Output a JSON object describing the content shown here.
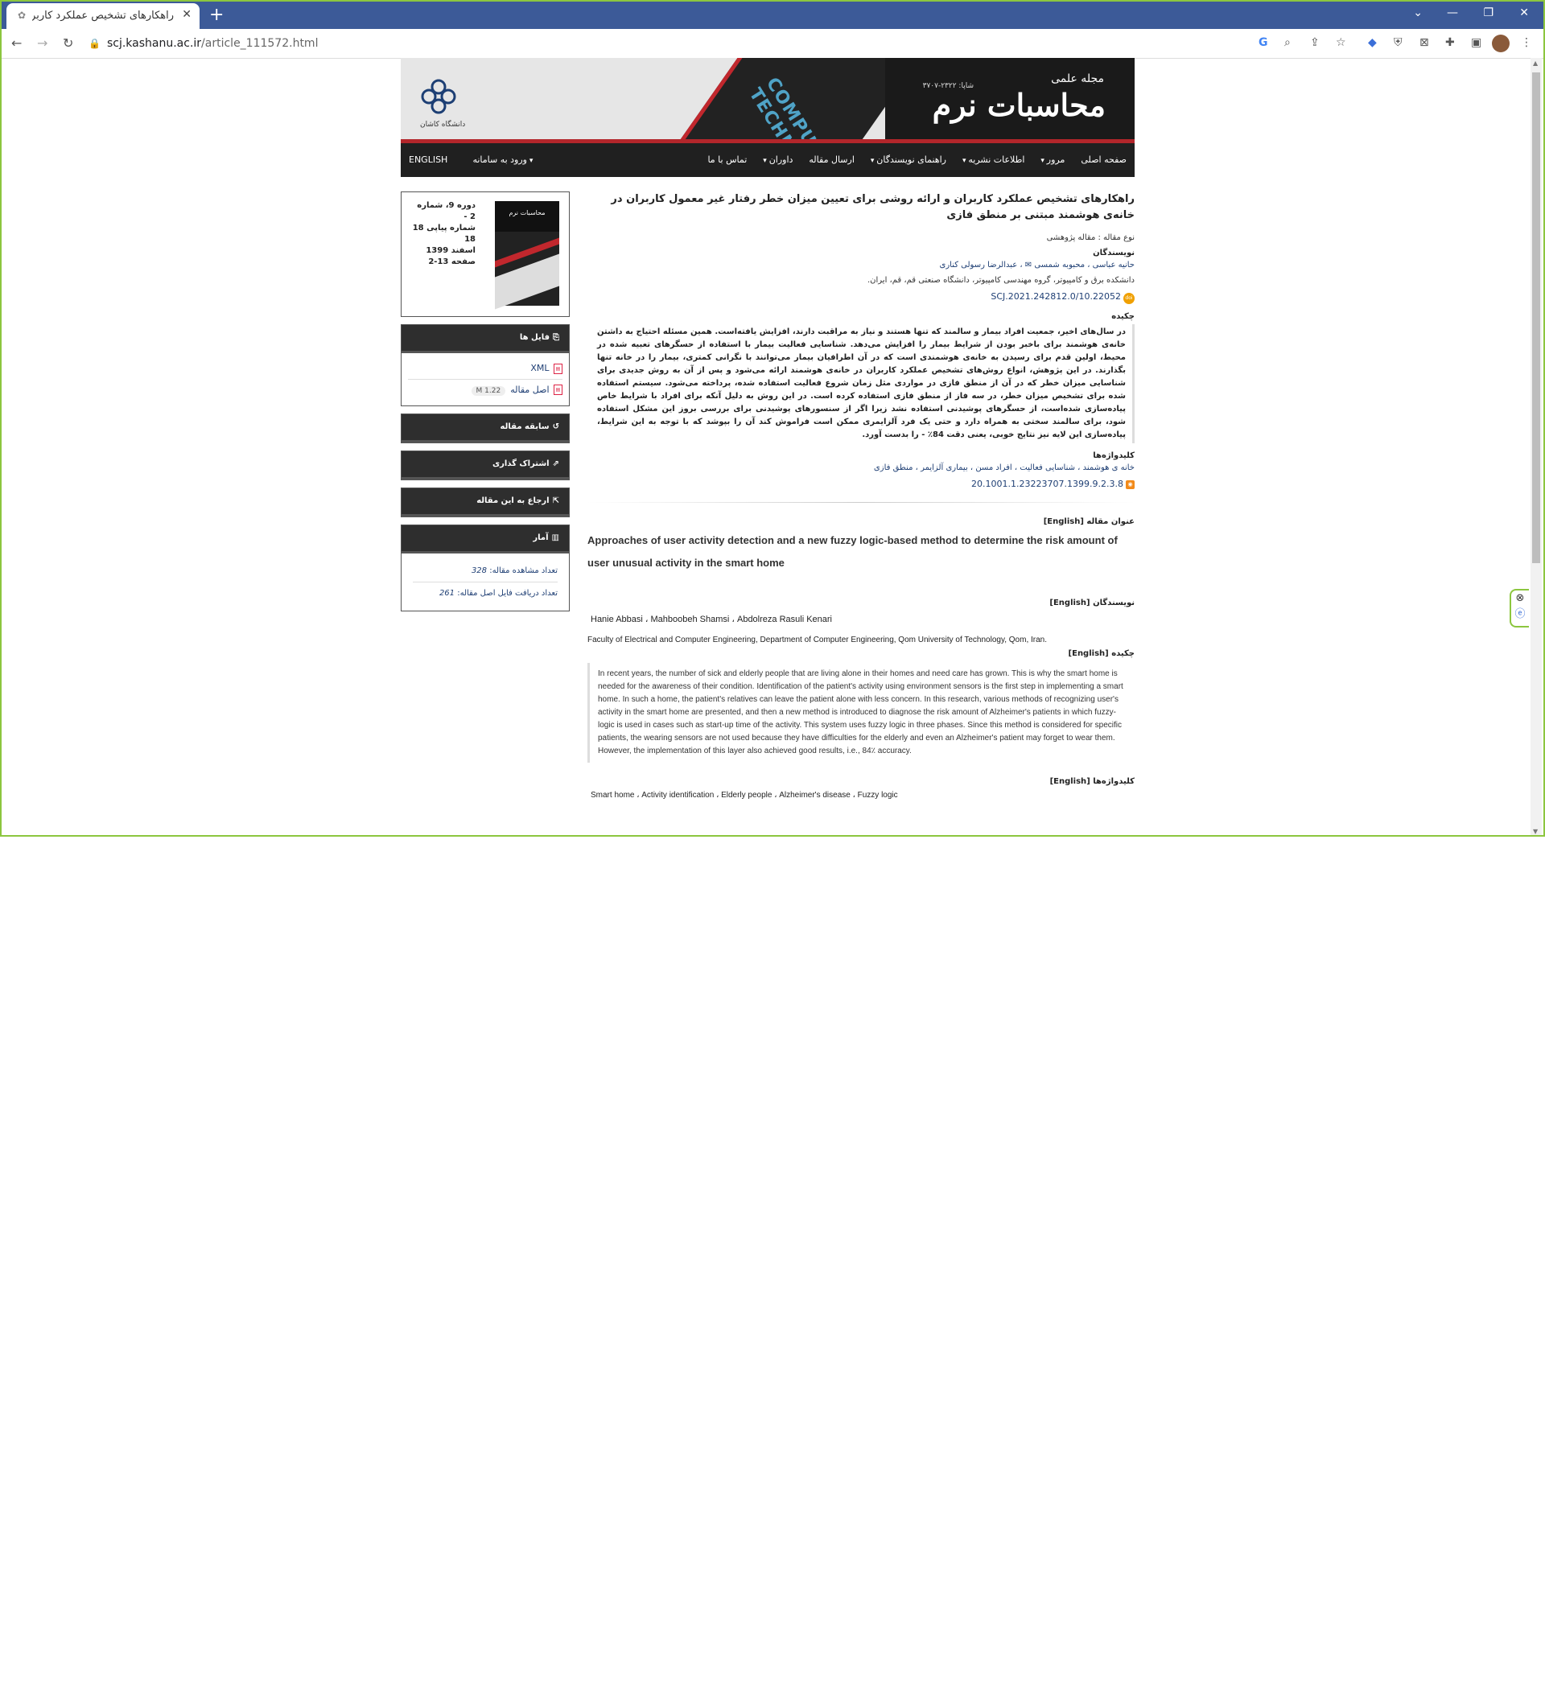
{
  "browser": {
    "tab_title": "راهکارهای تشخیص عملکرد کاربران",
    "url_host": "scj.kashanu.ac.ir",
    "url_path": "/article_111572.html"
  },
  "banner": {
    "magazine_small": "مجله علمی",
    "magazine_name": "محاسبات نرم",
    "issn": "شاپا: ۲۳۲۲-۳۷۰۷",
    "cover_words": "COMPUTER ENGINEERING TECHNOLOGY",
    "logo_text": "دانشگاه کاشان"
  },
  "nav": {
    "items": [
      "صفحه اصلی",
      "مرور",
      "اطلاعات نشریه",
      "راهنمای نویسندگان",
      "ارسال مقاله",
      "داوران",
      "تماس با ما"
    ],
    "login": "ورود به سامانه",
    "english": "ENGLISH"
  },
  "sidebar": {
    "issue_info": [
      "دوره 9، شماره 2 -",
      "شماره پیاپی 18",
      "18",
      "اسفند 1399",
      "صفحه 13-2"
    ],
    "cover_title": "محاسبات نرم",
    "files_header": "فایل ها",
    "files": [
      {
        "label": "XML",
        "size": ""
      },
      {
        "label": "اصل مقاله",
        "size": "1.22 M"
      }
    ],
    "history": "سابقه مقاله",
    "share": "اشتراک گذاری",
    "cite": "ارجاع به این مقاله",
    "stats_header": "آمار",
    "stats": [
      {
        "label": "تعداد مشاهده مقاله:",
        "value": "328"
      },
      {
        "label": "تعداد دریافت فایل اصل مقاله:",
        "value": "261"
      }
    ]
  },
  "article": {
    "title": "راهکارهای تشخیص عملکرد کاربران و ارائه روشی برای تعیین میزان خطر رفتار غیر معمول کاربران در خانه‌ی هوشمند مبتنی بر منطق فازی",
    "type_label": "نوع مقاله : مقاله پژوهشی",
    "authors_label": "نویسندگان",
    "authors": "حانیه عباسی ، محبوبه شمسی ✉ ، عبدالرضا رسولی کناری",
    "affiliation": "دانشکده برق و کامپیوتر، گروه مهندسی کامپیوتر، دانشگاه صنعتی قم، قم، ایران.",
    "doi": "10.22052/SCJ.2021.242812.0",
    "abstract_label": "چکیده",
    "abstract": "در سال‌های اخیر، جمعیت افراد بیمار و سالمند که تنها هستند و نیاز به مراقبت دارند، افزایش یافته‌است. همین مسئله احتیاج به داشتن خانه‌ی هوشمند برای باخبر بودن از شرایط بیمار را افزایش می‌دهد. شناسایی فعالیت بیمار با استفاده از حسگرهای تعبیه شده در محیط، اولین قدم برای رسیدن به خانه‌ی هوشمندی است که در آن اطرافیان بیمار می‌توانند با نگرانی کمتری، بیمار را در خانه تنها بگذارند. در این پژوهش، انواع روش‌های تشخیص عملکرد کاربران در خانه‌ی هوشمند ارائه می‌شود و پس از آن به روش جدیدی برای شناسایی میزان خطر که در آن از منطق فازی در مواردی مثل زمان شروع فعالیت استفاده شده، پرداخته می‌شود. سیستم استفاده شده برای تشخیص میزان خطر، در سه فاز از منطق فازی استفاده کرده است. در این روش به دلیل آنکه برای افراد با شرایط خاص پیاده‌سازی شده‌است، از حسگرهای پوشیدنی استفاده نشد زیرا اگر از سنسورهای پوشیدنی برای بررسی بروز این مشکل استفاده شود، برای سالمند سختی به همراه دارد و حتی یک فرد آلزایمری ممکن است فراموش کند آن را بپوشد که با توجه به این شرایط، پیاده‌سازی این لایه نیز نتایج خوبی، یعنی دقت 84٪ - را بدست آورد.",
    "keywords_label": "کلیدواژه‌ها",
    "keywords": "خانه ی هوشمند ، شناسایی فعالیت ، افراد مسن ، بیماری آلزایمر ، منطق فازی",
    "dor": "20.1001.1.23223707.1399.9.2.3.8"
  },
  "english": {
    "title_label": "عنوان مقاله [English]",
    "title": "Approaches of user activity detection and a new fuzzy logic-based method to determine the risk amount of user unusual activity in the smart home",
    "authors_label": "نویسندگان [English]",
    "authors": "Hanie Abbasi ، Mahboobeh Shamsi ، Abdolreza Rasuli Kenari",
    "affiliation": "Faculty of Electrical and Computer Engineering, Department of Computer Engineering, Qom University of Technology, Qom, Iran.",
    "abstract_label": "چکیده [English]",
    "abstract": "In recent years, the number of sick and elderly people that are living alone in their homes and need care has grown. This is why the smart home is needed for the awareness of their condition. Identification of the patient's activity using environment sensors is the first step in implementing a smart home. In such a home, the patient's relatives can leave the patient alone with less concern. In this research, various methods of recognizing user's activity in the smart home are presented, and then a new method is introduced to diagnose the risk amount of Alzheimer's patients in which fuzzy-logic is used in cases such as start-up time of the activity. This system uses fuzzy logic in three phases. Since this method is considered for specific patients, the wearing sensors are not used because they have difficulties for the elderly and even an Alzheimer's patient may forget to wear them. However, the implementation of this layer also achieved good results, i.e., 84٪ accuracy.",
    "keywords_label": "کلیدواژه‌ها [English]",
    "keywords": "Smart home ، Activity identification ، Elderly people ، Alzheimer's disease ، Fuzzy logic"
  }
}
